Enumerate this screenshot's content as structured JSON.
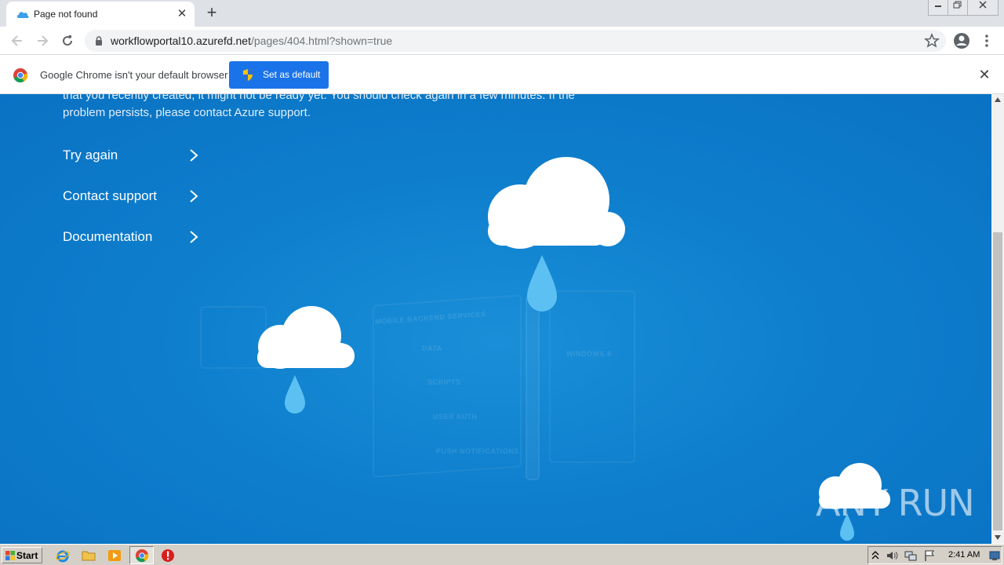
{
  "browser": {
    "tab_title": "Page not found",
    "new_tab_symbol": "+",
    "close_symbol": "✕",
    "url_host": "workflowportal10.azurefd.net",
    "url_path": "/pages/404.html?shown=true"
  },
  "infobar": {
    "message": "Google Chrome isn't your default browser",
    "button_label": "Set as default",
    "close_symbol": "✕"
  },
  "page": {
    "message": "that you recently created, it might not be ready yet. You should check again in a few minutes. If the problem persists, please contact Azure support.",
    "links": [
      {
        "label": "Try again"
      },
      {
        "label": "Contact support"
      },
      {
        "label": "Documentation"
      }
    ],
    "background_labels": {
      "mobile_backend": "MOBILE BACKEND SERVICES",
      "data": "DATA",
      "scripts": "SCRIPTS",
      "user_auth": "USER AUTH",
      "push": "PUSH NOTIFICATIONS",
      "windows": "WINDOWS 8"
    }
  },
  "watermark": {
    "text": "ANY RUN"
  },
  "taskbar": {
    "start_label": "Start",
    "clock": "2:41 AM"
  },
  "colors": {
    "page_blue": "#0e7fcd",
    "button_blue": "#1a73e8",
    "tab_strip": "#dee1e6"
  }
}
